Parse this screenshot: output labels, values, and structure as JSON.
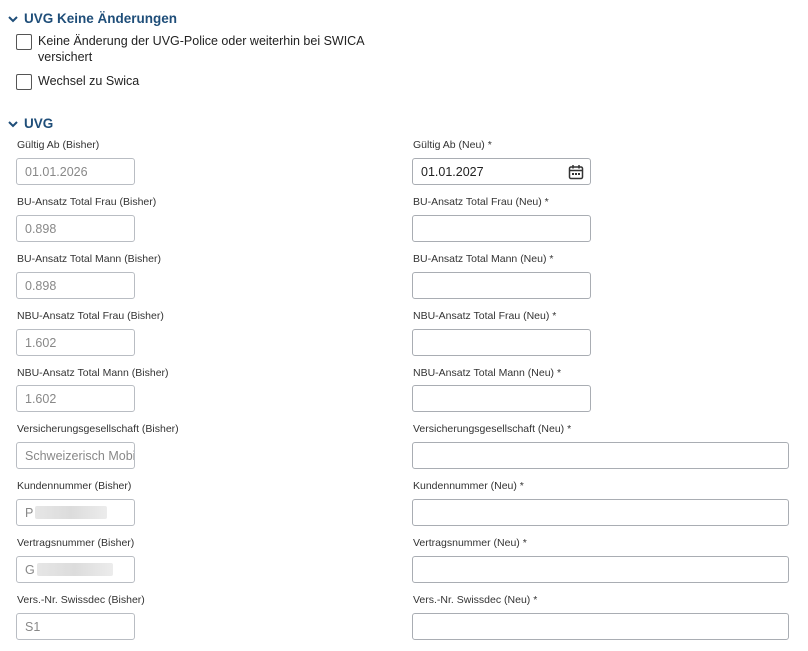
{
  "sections": {
    "uvg_keine": {
      "title": "UVG Keine Änderungen",
      "options": [
        "Keine Änderung der UVG-Police oder weiterhin bei SWICA versichert",
        "Wechsel zu Swica"
      ]
    },
    "uvg": {
      "title": "UVG"
    }
  },
  "fields": [
    {
      "bisher_label": "Gültig Ab (Bisher)",
      "bisher_value": "01.01.2026",
      "neu_label": "Gültig Ab (Neu) *",
      "neu_value": "01.01.2027"
    },
    {
      "bisher_label": "BU-Ansatz Total Frau (Bisher)",
      "bisher_value": "0.898",
      "neu_label": "BU-Ansatz Total Frau (Neu) *",
      "neu_value": ""
    },
    {
      "bisher_label": "BU-Ansatz Total Mann (Bisher)",
      "bisher_value": "0.898",
      "neu_label": "BU-Ansatz Total Mann (Neu) *",
      "neu_value": ""
    },
    {
      "bisher_label": "NBU-Ansatz Total Frau (Bisher)",
      "bisher_value": "1.602",
      "neu_label": "NBU-Ansatz Total Frau (Neu) *",
      "neu_value": ""
    },
    {
      "bisher_label": "NBU-Ansatz Total Mann (Bisher)",
      "bisher_value": "1.602",
      "neu_label": "NBU-Ansatz Total Mann (Neu) *",
      "neu_value": ""
    },
    {
      "bisher_label": "Versicherungsgesellschaft (Bisher)",
      "bisher_value": "Schweizerisch Mobi",
      "neu_label": "Versicherungsgesellschaft (Neu) *",
      "neu_value": ""
    },
    {
      "bisher_label": "Kundennummer (Bisher)",
      "bisher_value": "P",
      "neu_label": "Kundennummer (Neu) *",
      "neu_value": ""
    },
    {
      "bisher_label": "Vertragsnummer (Bisher)",
      "bisher_value": "G",
      "neu_label": "Vertragsnummer (Neu) *",
      "neu_value": ""
    },
    {
      "bisher_label": "Vers.-Nr. Swissdec (Bisher)",
      "bisher_value": "S1",
      "neu_label": "Vers.-Nr. Swissdec (Neu) *",
      "neu_value": ""
    }
  ],
  "colors": {
    "section_title": "#1f4e79",
    "input_border": "#b9bdc3",
    "readonly_text": "#888888"
  },
  "icons": {
    "section_toggle": "chevron-down-icon",
    "date_picker": "calendar-icon"
  }
}
